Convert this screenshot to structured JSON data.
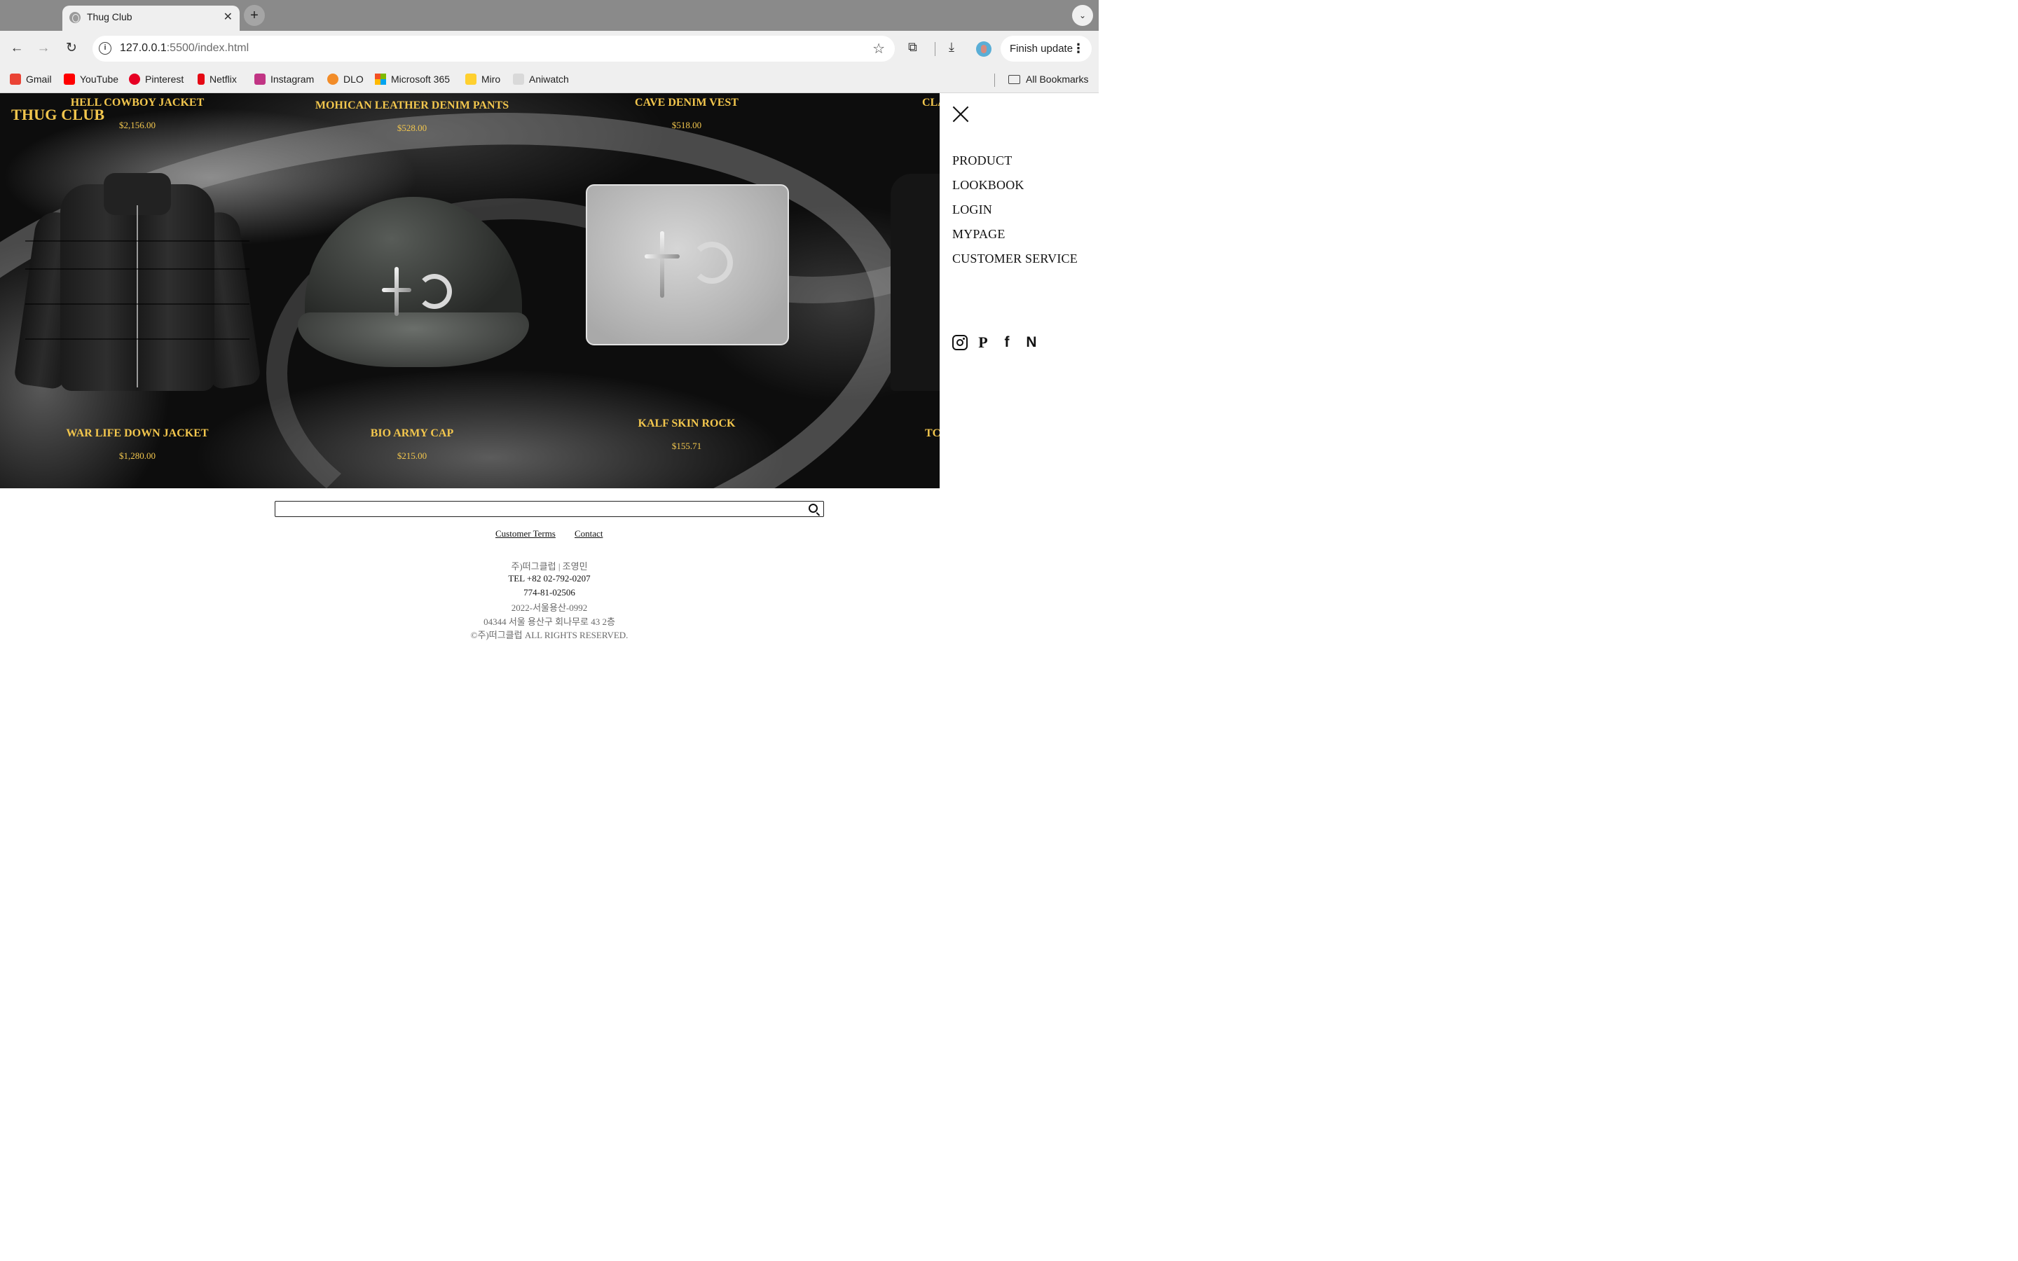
{
  "browser": {
    "tab_title": "Thug Club",
    "url_host": "127.0.0.1",
    "url_rest": ":5500/index.html",
    "update_button": "Finish update",
    "bookmarks": [
      {
        "label": "Gmail",
        "color": "#ea4335"
      },
      {
        "label": "YouTube",
        "color": "#ff0000"
      },
      {
        "label": "Pinterest",
        "color": "#e60023"
      },
      {
        "label": "Netflix",
        "color": "#e50914"
      },
      {
        "label": "Instagram",
        "color": "#c13584"
      },
      {
        "label": "DLO",
        "color": "#f28c28"
      },
      {
        "label": "Microsoft 365",
        "color": "#0078d4"
      },
      {
        "label": "Miro",
        "color": "#ffd02f"
      },
      {
        "label": "Aniwatch",
        "color": "#bdbdbd"
      }
    ],
    "all_bookmarks": "All Bookmarks"
  },
  "site": {
    "logo": "THUG CLUB",
    "accent_color": "#f2c64d",
    "top_products": [
      {
        "name": "HELL COWBOY JACKET",
        "price": "$2,156.00"
      },
      {
        "name": "MOHICAN LEATHER DENIM PANTS",
        "price": "$528.00"
      },
      {
        "name": "CAVE DENIM VEST",
        "price": "$518.00"
      },
      {
        "name": "CLA",
        "price": ""
      }
    ],
    "bottom_products": [
      {
        "name": "WAR LIFE DOWN JACKET",
        "price": "$1,280.00"
      },
      {
        "name": "BIO ARMY CAP",
        "price": "$215.00"
      },
      {
        "name": "KALF SKIN ROCK",
        "price": "$155.71"
      },
      {
        "name": "TC",
        "price": ""
      }
    ]
  },
  "menu": {
    "items": [
      "PRODUCT",
      "LOOKBOOK",
      "LOGIN",
      "MYPAGE",
      "CUSTOMER SERVICE"
    ],
    "social_icons": [
      "instagram-icon",
      "pinterest-icon",
      "facebook-icon",
      "naver-icon"
    ],
    "pinterest_glyph": "P",
    "facebook_glyph": "f",
    "naver_glyph": "N"
  },
  "footer": {
    "links": [
      "Customer Terms",
      "Contact"
    ],
    "company": "주)떠그클럽 | 조영민",
    "tel": "TEL +82 02-792-0207",
    "business_no": "774-81-02506",
    "mail_order_no": "2022-서울용산-0992",
    "address": "04344 서울 용산구 회나무로 43 2층",
    "copyright": "©주)떠그클럽 ALL RIGHTS RESERVED."
  }
}
